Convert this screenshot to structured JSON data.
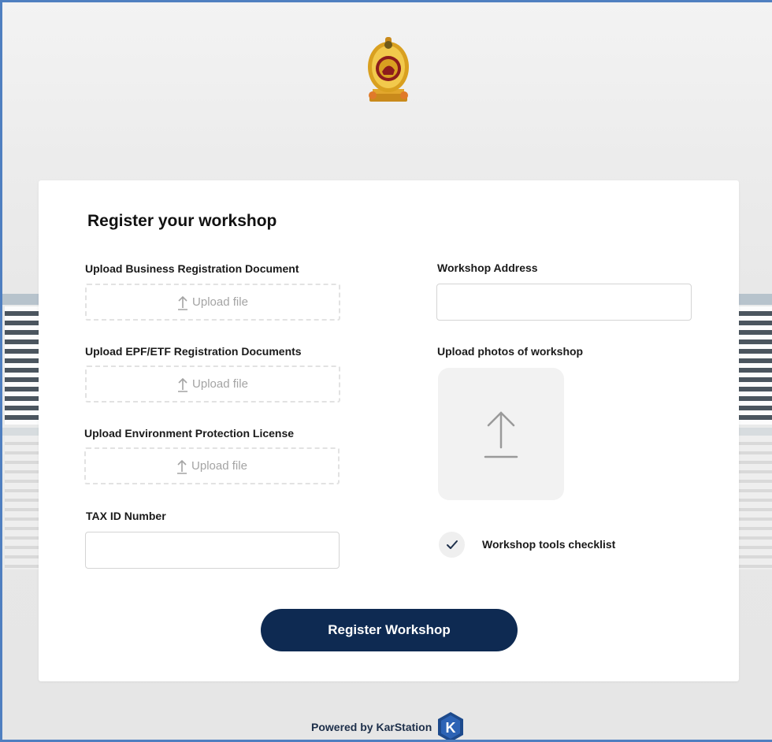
{
  "form": {
    "title": "Register your workshop",
    "business_registration": {
      "label": "Upload Business Registration Document",
      "upload_text": "Upload file"
    },
    "epf_etf": {
      "label": "Upload EPF/ETF Registration Documents",
      "upload_text": "Upload file"
    },
    "environment_license": {
      "label": "Upload Environment Protection License",
      "upload_text": "Upload file"
    },
    "tax_id": {
      "label": "TAX ID Number",
      "value": "",
      "placeholder": ""
    },
    "workshop_address": {
      "label": "Workshop Address",
      "value": "",
      "placeholder": ""
    },
    "workshop_photos": {
      "label": "Upload photos of workshop",
      "icon": "upload-arrow-icon"
    },
    "tools_checklist": {
      "label": "Workshop tools checklist",
      "icon": "checkmark-icon",
      "checked": true
    },
    "submit_label": "Register Workshop"
  },
  "footer": {
    "powered_by": "Powered by KarStation",
    "logo_letter": "K"
  },
  "colors": {
    "primary": "#0e2a52",
    "frame_border": "#4f7fc0",
    "placeholder_gray": "#a4a4a4"
  }
}
